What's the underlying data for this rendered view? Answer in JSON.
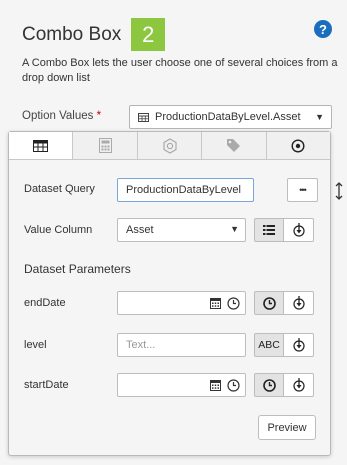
{
  "header": {
    "title": "Combo Box",
    "step": "2",
    "description": "A Combo Box lets the user choose one of several choices from a drop down list"
  },
  "option_values": {
    "label": "Option Values",
    "required_mark": "*",
    "value": "ProductionDataByLevel.Asset"
  },
  "tabs": [
    {
      "icon": "table-icon",
      "active": true
    },
    {
      "icon": "calculator-icon",
      "active": false
    },
    {
      "icon": "gear-settings-icon",
      "active": false
    },
    {
      "icon": "tag-icon",
      "active": false
    },
    {
      "icon": "target-icon",
      "active": false
    }
  ],
  "dataset_query": {
    "label": "Dataset Query",
    "value": "ProductionDataByLevel",
    "more_label": "•••"
  },
  "value_column": {
    "label": "Value Column",
    "value": "Asset"
  },
  "parameters": {
    "heading": "Dataset Parameters",
    "items": [
      {
        "label": "endDate",
        "value": "",
        "placeholder": ""
      },
      {
        "label": "level",
        "value": "",
        "placeholder": "Text..."
      },
      {
        "label": "startDate",
        "value": "",
        "placeholder": ""
      }
    ],
    "abc_label": "ABC"
  },
  "preview_label": "Preview",
  "colors": {
    "accent_green": "#8dc63f",
    "help_blue": "#1a6ebd",
    "required_red": "#cc0000"
  }
}
